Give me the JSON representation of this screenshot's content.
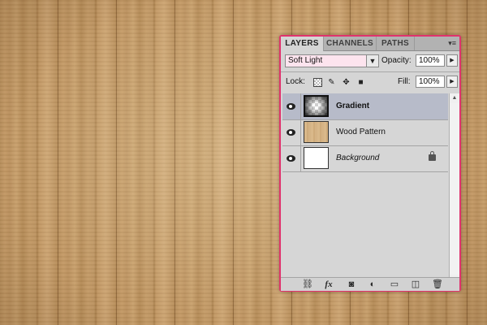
{
  "panel": {
    "tabs": [
      "LAYERS",
      "CHANNELS",
      "PATHS"
    ],
    "active_tab": "LAYERS",
    "menu_glyph": "▾≡",
    "blend_mode": "Soft Light",
    "opacity_label": "Opacity:",
    "opacity_value": "100%",
    "lock_label": "Lock:",
    "fill_label": "Fill:",
    "fill_value": "100%",
    "accent_border": "#e0336d",
    "layers": [
      {
        "name": "Gradient",
        "visible": true,
        "selected": true,
        "thumbnail": "transparent-checker-icon"
      },
      {
        "name": "Wood Pattern",
        "visible": true,
        "selected": false,
        "thumbnail": "wood-texture"
      },
      {
        "name": "Background",
        "visible": true,
        "selected": false,
        "thumbnail": "white-fill",
        "locked": true
      }
    ],
    "bottom_icons": [
      "link-layers-icon",
      "fx-icon",
      "layer-mask-icon",
      "adjustment-layer-icon",
      "new-group-icon",
      "new-layer-icon",
      "trash-icon"
    ],
    "fx_text": "fx"
  }
}
